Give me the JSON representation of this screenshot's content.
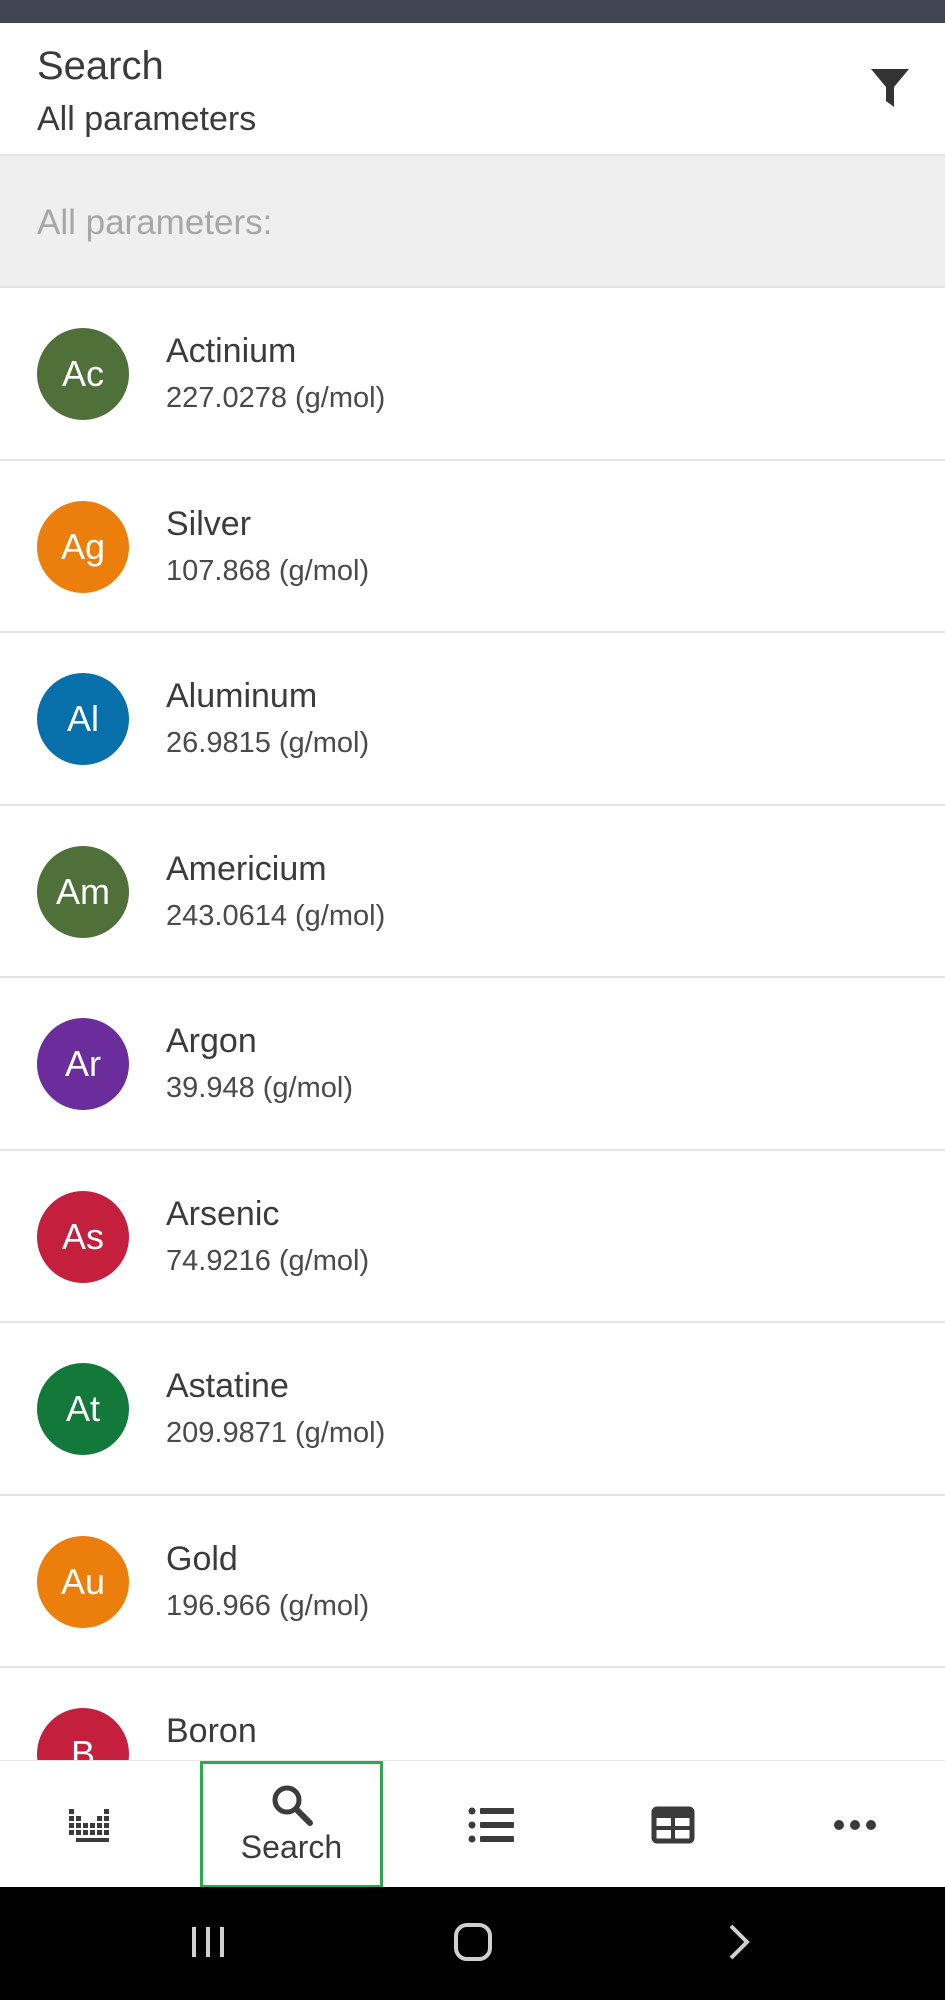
{
  "header": {
    "title": "Search",
    "subtitle": "All parameters"
  },
  "section": {
    "label": "All parameters:"
  },
  "elements": [
    {
      "symbol": "Ac",
      "name": "Actinium",
      "mass": "227.0278 (g/mol)",
      "color": "#4f7039"
    },
    {
      "symbol": "Ag",
      "name": "Silver",
      "mass": "107.868 (g/mol)",
      "color": "#ec7f0c"
    },
    {
      "symbol": "Al",
      "name": "Aluminum",
      "mass": "26.9815 (g/mol)",
      "color": "#076fa9"
    },
    {
      "symbol": "Am",
      "name": "Americium",
      "mass": "243.0614 (g/mol)",
      "color": "#4f7039"
    },
    {
      "symbol": "Ar",
      "name": "Argon",
      "mass": "39.948 (g/mol)",
      "color": "#6a2d9b"
    },
    {
      "symbol": "As",
      "name": "Arsenic",
      "mass": "74.9216 (g/mol)",
      "color": "#c51f3e"
    },
    {
      "symbol": "At",
      "name": "Astatine",
      "mass": "209.9871 (g/mol)",
      "color": "#12793b"
    },
    {
      "symbol": "Au",
      "name": "Gold",
      "mass": "196.966 (g/mol)",
      "color": "#ec7f0c"
    },
    {
      "symbol": "B",
      "name": "Boron",
      "mass": "",
      "color": "#c51f3e"
    }
  ],
  "nav": {
    "items": [
      {
        "icon": "periodic-table-icon",
        "label": ""
      },
      {
        "icon": "search-icon",
        "label": "Search",
        "active": true
      },
      {
        "icon": "list-icon",
        "label": ""
      },
      {
        "icon": "table-icon",
        "label": ""
      },
      {
        "icon": "more-icon",
        "label": ""
      }
    ]
  },
  "colors": {
    "active_outline": "#2fa84f",
    "status_bar": "#3f4552"
  }
}
